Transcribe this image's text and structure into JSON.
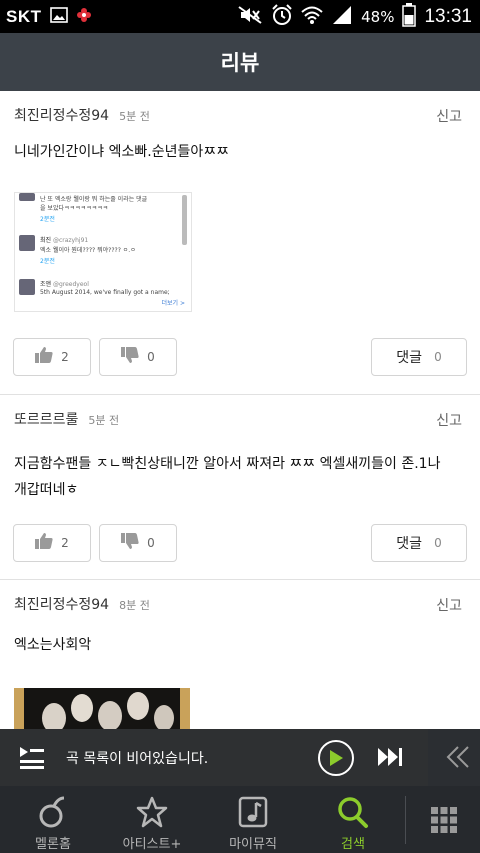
{
  "status_bar": {
    "carrier": "SKT",
    "battery": "48%",
    "time": "13:31"
  },
  "header": {
    "title": "리뷰"
  },
  "reviews": [
    {
      "author": "최진리정수정94",
      "time": "5분 전",
      "report": "신고",
      "text": "니네가인간이냐 엑소빠.순년들아ㅉㅉ",
      "likes": "2",
      "dislikes": "0",
      "comment_label": "댓글",
      "comments": "0",
      "embedded": {
        "line1": "난 또 엑소랑 웰이랑 뭐 하는줄 이라는 댓글",
        "line2": "을 보았다ㅋㅋㅋㅋㅋㅋㅋㅋ",
        "time1": "2분전",
        "name2": "최진",
        "handle2": "@crazyhj91",
        "line3": "엑소 웰이아 뭔데???? 뭐야???? ㅇ.ㅇ",
        "time2": "2분전",
        "name3": "조앤",
        "handle3": "@greedyeol",
        "line4": "5th August 2014, we've finally got a name;",
        "more": "더보기 >"
      }
    },
    {
      "author": "또르르르룰",
      "time": "5분 전",
      "report": "신고",
      "text_line1": "지금함수팬들 ㅈㄴ빡친상태니깐 알아서 짜져라 ㅉㅉ 엑셀새끼들이 존.1나",
      "text_line2": "개갑떠네ㅎ",
      "likes": "2",
      "dislikes": "0",
      "comment_label": "댓글",
      "comments": "0"
    },
    {
      "author": "최진리정수정94",
      "time": "8분 전",
      "report": "신고",
      "text": "엑소는사회악"
    }
  ],
  "player": {
    "message": "곡 목록이 비어있습니다."
  },
  "bottom_nav": [
    {
      "label": "멜론홈",
      "icon": "melon-home-icon",
      "active": false
    },
    {
      "label": "아티스트+",
      "icon": "star-icon",
      "active": false
    },
    {
      "label": "마이뮤직",
      "icon": "music-note-icon",
      "active": false
    },
    {
      "label": "검색",
      "icon": "search-icon",
      "active": true
    },
    {
      "label": "",
      "icon": "grid-menu-icon",
      "active": false
    }
  ],
  "colors": {
    "header_bg": "#3c4249",
    "nav_bg": "#26292d",
    "accent": "#8ccc2c"
  }
}
